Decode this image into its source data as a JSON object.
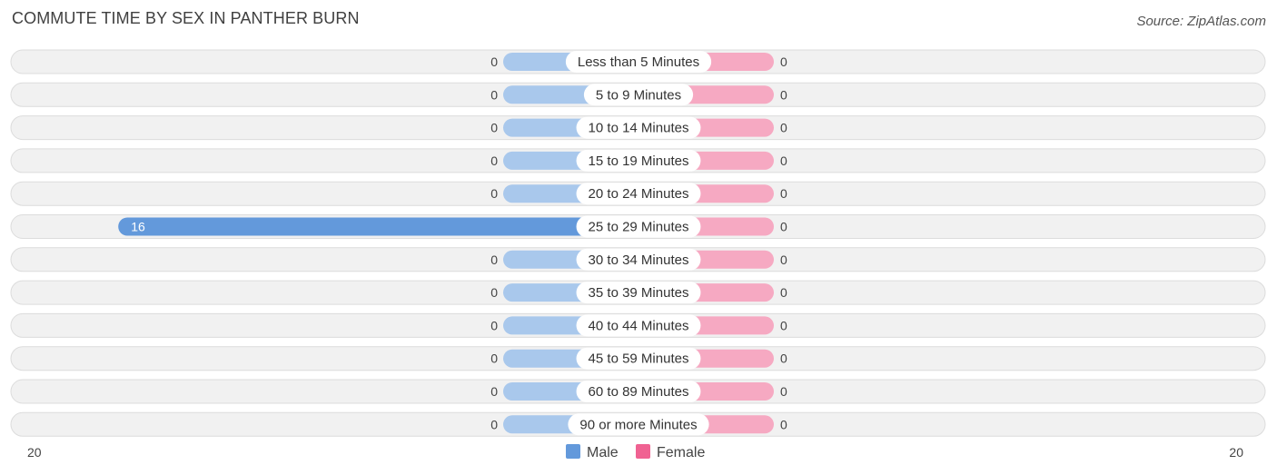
{
  "title": "COMMUTE TIME BY SEX IN PANTHER BURN",
  "source": "Source: ZipAtlas.com",
  "colors": {
    "male": "#6399db",
    "male_light": "#a9c8ec",
    "female": "#f06292",
    "female_light": "#f6a9c2",
    "row_bg": "#f1f1f1"
  },
  "chart_data": {
    "type": "bar",
    "orientation": "horizontal-diverging",
    "title": "COMMUTE TIME BY SEX IN PANTHER BURN",
    "categories": [
      "Less than 5 Minutes",
      "5 to 9 Minutes",
      "10 to 14 Minutes",
      "15 to 19 Minutes",
      "20 to 24 Minutes",
      "25 to 29 Minutes",
      "30 to 34 Minutes",
      "35 to 39 Minutes",
      "40 to 44 Minutes",
      "45 to 59 Minutes",
      "60 to 89 Minutes",
      "90 or more Minutes"
    ],
    "series": [
      {
        "name": "Male",
        "side": "left",
        "values": [
          0,
          0,
          0,
          0,
          0,
          16,
          0,
          0,
          0,
          0,
          0,
          0
        ]
      },
      {
        "name": "Female",
        "side": "right",
        "values": [
          0,
          0,
          0,
          0,
          0,
          0,
          0,
          0,
          0,
          0,
          0,
          0
        ]
      }
    ],
    "axis": {
      "left_max": 20,
      "right_max": 20,
      "left_tick_label": "20",
      "right_tick_label": "20"
    },
    "legend": {
      "position": "bottom-center",
      "entries": [
        "Male",
        "Female"
      ]
    },
    "grid": false
  }
}
